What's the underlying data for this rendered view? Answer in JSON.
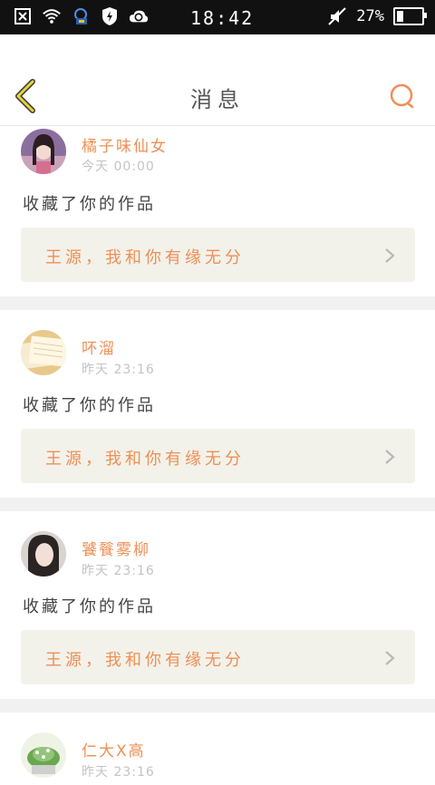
{
  "status_bar": {
    "time": "18:42",
    "battery_percent": "27%",
    "battery_level": 0.27,
    "icons": [
      "close-box-icon",
      "wifi-icon",
      "qq-bear-icon",
      "shield-bolt-icon",
      "cloud-sync-icon",
      "mute-icon",
      "battery-icon"
    ]
  },
  "header": {
    "title": "消息",
    "back_icon": "chevron-left-icon",
    "search_icon": "search-icon",
    "accent_color": "#ef8f55",
    "back_color": "#e8d23a"
  },
  "messages": [
    {
      "username": "橘子味仙女",
      "time": "今天 00:00",
      "action": "收藏了你的作品",
      "work_title": "王源，我和你有缘无分",
      "avatar": "girl-portrait"
    },
    {
      "username": "吥溜",
      "time": "昨天 23:16",
      "action": "收藏了你的作品",
      "work_title": "王源，我和你有缘无分",
      "avatar": "book-pages"
    },
    {
      "username": "饕餮雾柳",
      "time": "昨天 23:16",
      "action": "收藏了你的作品",
      "work_title": "王源，我和你有缘无分",
      "avatar": "girl-portrait-dark"
    },
    {
      "username": "仁大X高",
      "time": "昨天 23:16",
      "action": "",
      "work_title": "",
      "avatar": "green-cactus"
    }
  ]
}
